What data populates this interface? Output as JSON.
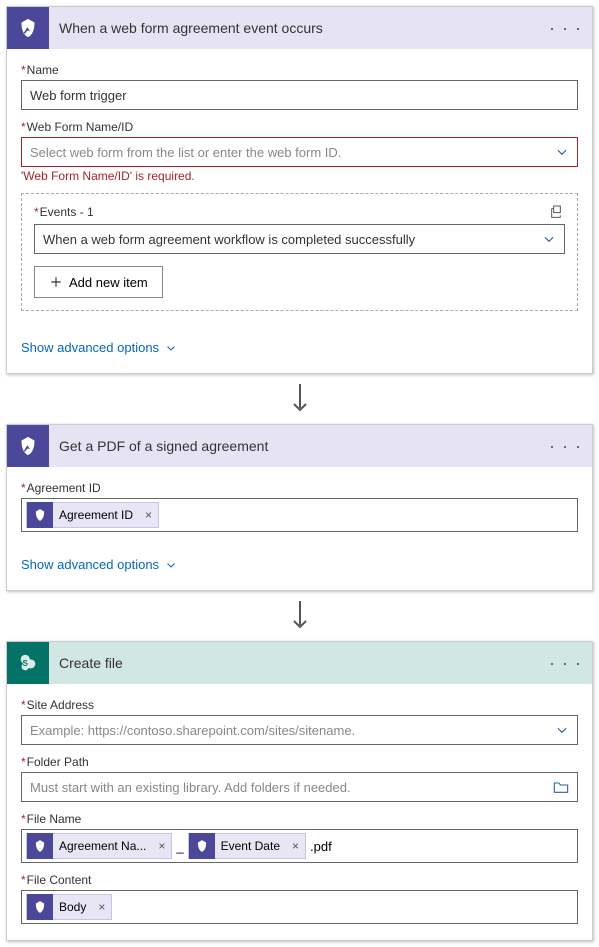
{
  "card1": {
    "title": "When a web form agreement event occurs",
    "name_label": "Name",
    "name_value": "Web form trigger",
    "webform_label": "Web Form Name/ID",
    "webform_placeholder": "Select web form from the list or enter the web form ID.",
    "webform_error": "'Web Form Name/ID' is required.",
    "events_label": "Events - 1",
    "events_value": "When a web form agreement workflow is completed successfully",
    "add_item": "Add new item",
    "advanced": "Show advanced options"
  },
  "card2": {
    "title": "Get a PDF of a signed agreement",
    "agreement_label": "Agreement ID",
    "token_agreement": "Agreement ID",
    "advanced": "Show advanced options"
  },
  "card3": {
    "title": "Create file",
    "site_label": "Site Address",
    "site_placeholder": "Example: https://contoso.sharepoint.com/sites/sitename.",
    "folder_label": "Folder Path",
    "folder_placeholder": "Must start with an existing library. Add folders if needed.",
    "filename_label": "File Name",
    "token_agname": "Agreement Na...",
    "sep": "_",
    "token_eventdate": "Event Date",
    "ext": ".pdf",
    "filecontent_label": "File Content",
    "token_body": "Body"
  }
}
